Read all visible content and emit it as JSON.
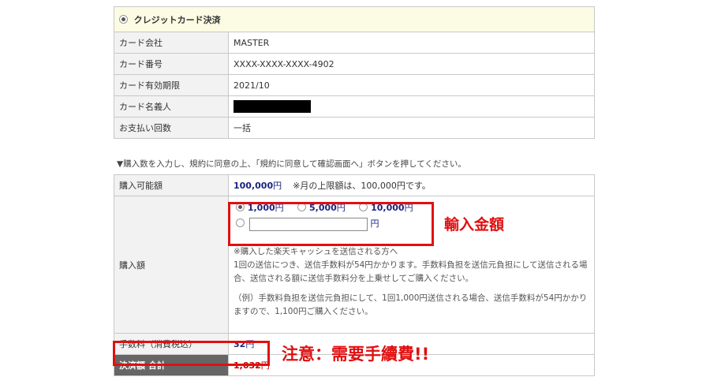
{
  "payment": {
    "section_label": "クレジットカード決済",
    "rows": [
      {
        "label": "カード会社",
        "value": "MASTER"
      },
      {
        "label": "カード番号",
        "value": "XXXX-XXXX-XXXX-4902"
      },
      {
        "label": "カード有効期限",
        "value": "2021/10"
      },
      {
        "label": "カード名義人",
        "value": ""
      },
      {
        "label": "お支払い回数",
        "value": "一括"
      }
    ]
  },
  "notice": "▼購入数を入力し、規約に同意の上、「規約に同意して確認画面へ」ボタンを押してください。",
  "purchase": {
    "available_label": "購入可能額",
    "available_amount": "100,000",
    "yen": "円",
    "available_note": "※月の上限額は、100,000円です。",
    "amount_label": "購入額",
    "options": [
      "1,000",
      "5,000",
      "10,000"
    ],
    "custom_unit": "円",
    "info_lines": [
      "※購入した楽天キャッシュを送信される方へ",
      "1回の送信につき、送信手数料が54円かかります。手数料負担を送信元負担にして送信される場合、送信される額に送信手数料分を上乗せしてご購入ください。",
      "（例）手数料負担を送信元負担にして、1回1,000円送信される場合、送信手数料が54円かかりますので、1,100円ご購入ください。"
    ],
    "fee_label": "手数料（消費税込）",
    "fee_value": "32",
    "total_label": "決済額 合計",
    "total_value": "1,032"
  },
  "annotations": {
    "amount": "輸入金額",
    "fee_warning": "注意：需要手續費!!"
  },
  "colors": {
    "annotation_red": "#e01010",
    "amount_navy": "#1a237e",
    "total_red": "#c00000"
  }
}
